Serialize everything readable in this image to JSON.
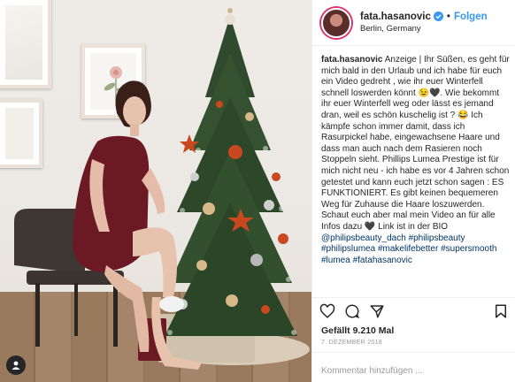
{
  "post": {
    "username": "fata.hasanovic",
    "follow_label": "Folgen",
    "separator": "•",
    "location": "Berlin, Germany",
    "caption_parts": [
      {
        "t": "text",
        "v": " Anzeige | Ihr Süßen, es geht für mich bald in den Urlaub und ich habe für euch ein Video gedreht , wie ihr euer Winterfell schnell loswerden könnt 😉🖤. Wie bekommt ihr euer Winterfell weg oder lässt es jemand dran, weil es schön kuschelig ist ? 😂 Ich kämpfe schon immer damit, dass ich Rasurpickel habe, eingewachsene Haare und dass man auch nach dem Rasieren noch Stoppeln sieht. Phillips Lumea Prestige ist für mich nicht neu - ich habe es vor 4 Jahren schon getestet und kann euch jetzt schon sagen : ES FUNKTIONIERT. Es gibt keinen bequemeren Weg für Zuhause die Haare loszuwerden. Schaut euch aber mal mein Video an für alle Infos dazu 🖤 Link ist in der BIO "
      },
      {
        "t": "tag",
        "v": "@philipsbeauty_dach"
      },
      {
        "t": "text",
        "v": " "
      },
      {
        "t": "tag",
        "v": "#philipsbeauty"
      },
      {
        "t": "text",
        "v": " "
      },
      {
        "t": "tag",
        "v": "#philipslumea"
      },
      {
        "t": "text",
        "v": " "
      },
      {
        "t": "tag",
        "v": "#makelifebetter"
      },
      {
        "t": "text",
        "v": " "
      },
      {
        "t": "tag",
        "v": "#supersmooth"
      },
      {
        "t": "text",
        "v": " "
      },
      {
        "t": "tag",
        "v": "#lumea"
      },
      {
        "t": "text",
        "v": " "
      },
      {
        "t": "tag",
        "v": "#fatahasanovic"
      }
    ],
    "likes": "Gefällt 9.210 Mal",
    "date": "7. DEZEMBER 2018",
    "comment_placeholder": "Kommentar hinzufügen ..."
  },
  "colors": {
    "accent": "#3897f0",
    "hashtag": "#003569",
    "muted": "#999999",
    "dress": "#6b1a24"
  },
  "icons": [
    "verified-badge-icon",
    "heart-icon",
    "comment-icon",
    "share-icon",
    "bookmark-icon",
    "user-tag-icon"
  ]
}
